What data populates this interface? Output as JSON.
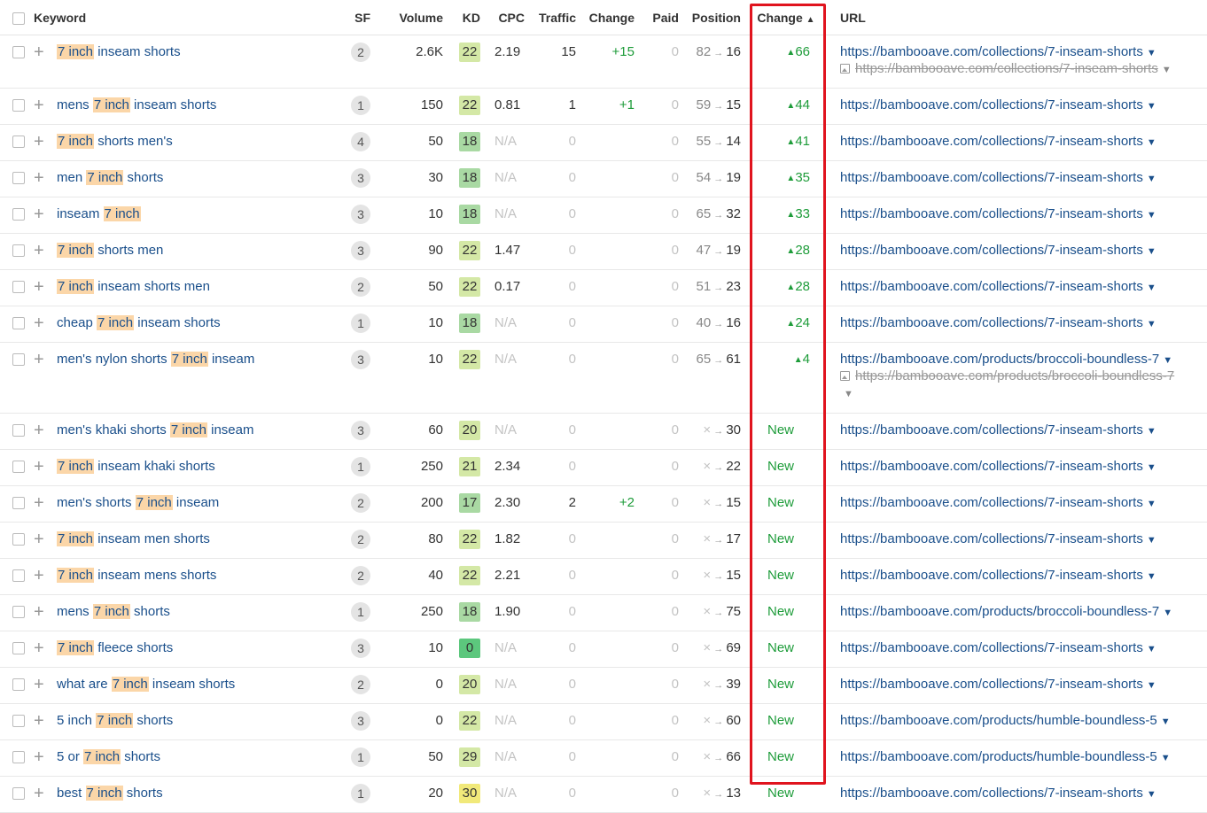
{
  "headers": {
    "keyword": "Keyword",
    "sf": "SF",
    "volume": "Volume",
    "kd": "KD",
    "cpc": "CPC",
    "traffic": "Traffic",
    "change": "Change",
    "paid": "Paid",
    "position": "Position",
    "pos_change": "Change",
    "url": "URL"
  },
  "colors": {
    "kd_green_light": "#d4e8a6",
    "kd_green": "#a9d9a3",
    "kd_green_bright": "#5cc77d",
    "kd_yellow": "#f1e97a",
    "highlight_box": "#e0141e"
  },
  "rows": [
    {
      "kw": [
        "",
        "7 inch",
        " inseam shorts"
      ],
      "sf": "2",
      "volume": "2.6K",
      "kd": "22",
      "cpc": "2.19",
      "traffic": "15",
      "change": "+15",
      "paid": "0",
      "pos_from": "82",
      "pos_to": "16",
      "pos_change": "66",
      "url": "https://bambooave.com/collections/7-inseam-shorts",
      "old_url": "https://bambooave.com/collections/7-inseam-shorts"
    },
    {
      "kw": [
        "mens ",
        "7 inch",
        " inseam shorts"
      ],
      "sf": "1",
      "volume": "150",
      "kd": "22",
      "cpc": "0.81",
      "traffic": "1",
      "change": "+1",
      "paid": "0",
      "pos_from": "59",
      "pos_to": "15",
      "pos_change": "44",
      "url": "https://bambooave.com/collections/7-inseam-shorts"
    },
    {
      "kw": [
        "",
        "7 inch",
        " shorts men's"
      ],
      "sf": "4",
      "volume": "50",
      "kd": "18",
      "cpc": "N/A",
      "traffic": "0",
      "change": "",
      "paid": "0",
      "pos_from": "55",
      "pos_to": "14",
      "pos_change": "41",
      "url": "https://bambooave.com/collections/7-inseam-shorts"
    },
    {
      "kw": [
        "men ",
        "7 inch",
        " shorts"
      ],
      "sf": "3",
      "volume": "30",
      "kd": "18",
      "cpc": "N/A",
      "traffic": "0",
      "change": "",
      "paid": "0",
      "pos_from": "54",
      "pos_to": "19",
      "pos_change": "35",
      "url": "https://bambooave.com/collections/7-inseam-shorts"
    },
    {
      "kw": [
        "inseam ",
        "7 inch",
        ""
      ],
      "sf": "3",
      "volume": "10",
      "kd": "18",
      "cpc": "N/A",
      "traffic": "0",
      "change": "",
      "paid": "0",
      "pos_from": "65",
      "pos_to": "32",
      "pos_change": "33",
      "url": "https://bambooave.com/collections/7-inseam-shorts"
    },
    {
      "kw": [
        "",
        "7 inch",
        " shorts men"
      ],
      "sf": "3",
      "volume": "90",
      "kd": "22",
      "cpc": "1.47",
      "traffic": "0",
      "change": "",
      "paid": "0",
      "pos_from": "47",
      "pos_to": "19",
      "pos_change": "28",
      "url": "https://bambooave.com/collections/7-inseam-shorts"
    },
    {
      "kw": [
        "",
        "7 inch",
        " inseam shorts men"
      ],
      "sf": "2",
      "volume": "50",
      "kd": "22",
      "cpc": "0.17",
      "traffic": "0",
      "change": "",
      "paid": "0",
      "pos_from": "51",
      "pos_to": "23",
      "pos_change": "28",
      "url": "https://bambooave.com/collections/7-inseam-shorts"
    },
    {
      "kw": [
        "cheap ",
        "7 inch",
        " inseam shorts"
      ],
      "sf": "1",
      "volume": "10",
      "kd": "18",
      "cpc": "N/A",
      "traffic": "0",
      "change": "",
      "paid": "0",
      "pos_from": "40",
      "pos_to": "16",
      "pos_change": "24",
      "url": "https://bambooave.com/collections/7-inseam-shorts"
    },
    {
      "kw": [
        "men's nylon shorts ",
        "7 inch",
        " inseam"
      ],
      "sf": "3",
      "volume": "10",
      "kd": "22",
      "cpc": "N/A",
      "traffic": "0",
      "change": "",
      "paid": "0",
      "pos_from": "65",
      "pos_to": "61",
      "pos_change": "4",
      "url": "https://bambooave.com/products/broccoli-boundless-7",
      "old_url": "https://bambooave.com/products/broccoli-boundless-7"
    },
    {
      "kw": [
        "men's khaki shorts ",
        "7 inch",
        " inseam"
      ],
      "sf": "3",
      "volume": "60",
      "kd": "20",
      "cpc": "N/A",
      "traffic": "0",
      "change": "",
      "paid": "0",
      "pos_from": "×",
      "pos_to": "30",
      "pos_change": "New",
      "url": "https://bambooave.com/collections/7-inseam-shorts"
    },
    {
      "kw": [
        "",
        "7 inch",
        " inseam khaki shorts"
      ],
      "sf": "1",
      "volume": "250",
      "kd": "21",
      "cpc": "2.34",
      "traffic": "0",
      "change": "",
      "paid": "0",
      "pos_from": "×",
      "pos_to": "22",
      "pos_change": "New",
      "url": "https://bambooave.com/collections/7-inseam-shorts"
    },
    {
      "kw": [
        "men's shorts ",
        "7 inch",
        " inseam"
      ],
      "sf": "2",
      "volume": "200",
      "kd": "17",
      "cpc": "2.30",
      "traffic": "2",
      "change": "+2",
      "paid": "0",
      "pos_from": "×",
      "pos_to": "15",
      "pos_change": "New",
      "url": "https://bambooave.com/collections/7-inseam-shorts"
    },
    {
      "kw": [
        "",
        "7 inch",
        " inseam men shorts"
      ],
      "sf": "2",
      "volume": "80",
      "kd": "22",
      "cpc": "1.82",
      "traffic": "0",
      "change": "",
      "paid": "0",
      "pos_from": "×",
      "pos_to": "17",
      "pos_change": "New",
      "url": "https://bambooave.com/collections/7-inseam-shorts"
    },
    {
      "kw": [
        "",
        "7 inch",
        " inseam mens shorts"
      ],
      "sf": "2",
      "volume": "40",
      "kd": "22",
      "cpc": "2.21",
      "traffic": "0",
      "change": "",
      "paid": "0",
      "pos_from": "×",
      "pos_to": "15",
      "pos_change": "New",
      "url": "https://bambooave.com/collections/7-inseam-shorts"
    },
    {
      "kw": [
        "mens ",
        "7 inch",
        " shorts"
      ],
      "sf": "1",
      "volume": "250",
      "kd": "18",
      "cpc": "1.90",
      "traffic": "0",
      "change": "",
      "paid": "0",
      "pos_from": "×",
      "pos_to": "75",
      "pos_change": "New",
      "url": "https://bambooave.com/products/broccoli-boundless-7"
    },
    {
      "kw": [
        "",
        "7 inch",
        " fleece shorts"
      ],
      "sf": "3",
      "volume": "10",
      "kd": "0",
      "cpc": "N/A",
      "traffic": "0",
      "change": "",
      "paid": "0",
      "pos_from": "×",
      "pos_to": "69",
      "pos_change": "New",
      "url": "https://bambooave.com/collections/7-inseam-shorts"
    },
    {
      "kw": [
        "what are ",
        "7 inch",
        " inseam shorts"
      ],
      "sf": "2",
      "volume": "0",
      "kd": "20",
      "cpc": "N/A",
      "traffic": "0",
      "change": "",
      "paid": "0",
      "pos_from": "×",
      "pos_to": "39",
      "pos_change": "New",
      "url": "https://bambooave.com/collections/7-inseam-shorts"
    },
    {
      "kw": [
        "5 inch ",
        "7 inch",
        " shorts"
      ],
      "sf": "3",
      "volume": "0",
      "kd": "22",
      "cpc": "N/A",
      "traffic": "0",
      "change": "",
      "paid": "0",
      "pos_from": "×",
      "pos_to": "60",
      "pos_change": "New",
      "url": "https://bambooave.com/products/humble-boundless-5"
    },
    {
      "kw": [
        "5 or ",
        "7 inch",
        " shorts"
      ],
      "sf": "1",
      "volume": "50",
      "kd": "29",
      "cpc": "N/A",
      "traffic": "0",
      "change": "",
      "paid": "0",
      "pos_from": "×",
      "pos_to": "66",
      "pos_change": "New",
      "url": "https://bambooave.com/products/humble-boundless-5"
    },
    {
      "kw": [
        "best ",
        "7 inch",
        " shorts"
      ],
      "sf": "1",
      "volume": "20",
      "kd": "30",
      "cpc": "N/A",
      "traffic": "0",
      "change": "",
      "paid": "0",
      "pos_from": "×",
      "pos_to": "13",
      "pos_change": "New",
      "url": "https://bambooave.com/collections/7-inseam-shorts"
    }
  ]
}
